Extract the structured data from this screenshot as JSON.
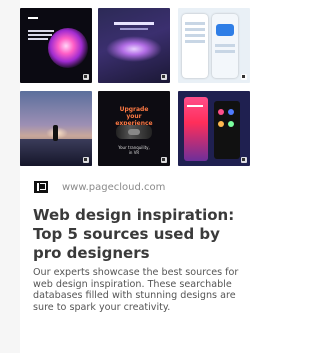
{
  "source": {
    "favicon": "pagecloud-logo-icon",
    "url": "www.pagecloud.com"
  },
  "thumbnails": [
    {
      "name": "dark-pink-glow-site-thumbnail",
      "caption_lines": [
        "Luxury interfaces for",
        "brands that define",
        "their era."
      ]
    },
    {
      "name": "purple-gradient-ring-site-thumbnail"
    },
    {
      "name": "mobile-app-screens-thumbnail"
    },
    {
      "name": "sunset-figure-scene-thumbnail"
    },
    {
      "name": "upgrade-experience-site-thumbnail",
      "heading": "Upgrade your experience",
      "footer": "Your tranquility, in VR"
    },
    {
      "name": "pink-mobile-ui-thumbnail"
    }
  ],
  "result": {
    "title": "Web design inspiration: Top 5 sources used by pro designers",
    "description": "Our experts showcase the best sources for web design inspiration. These searchable databases filled with stunning designs are sure to spark your creativity."
  }
}
